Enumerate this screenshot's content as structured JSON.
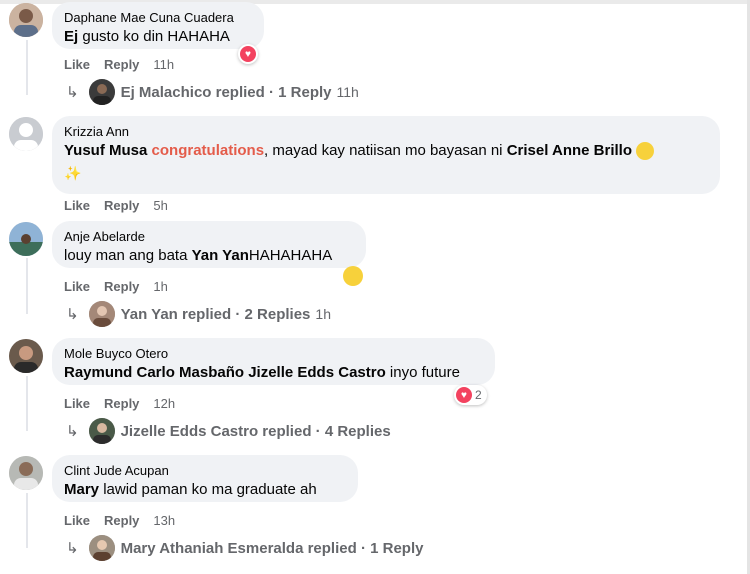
{
  "comments": [
    {
      "name": "Daphane Mae Cuna Cuadera",
      "text_tag": "Ej",
      "text_rest": " gusto ko din HAHAHA",
      "like": "Like",
      "reply": "Reply",
      "time": "11h",
      "replies_author": "Ej Malachico replied",
      "replies_count": "· 1 Reply",
      "replies_time": "11h"
    },
    {
      "name": "Krizzia Ann",
      "text_tag": "Yusuf Musa",
      "text_red": "congratulations",
      "text_mid": ", mayad kay natiisan mo bayasan ni ",
      "text_tag2": "Crisel Anne Brillo",
      "like": "Like",
      "reply": "Reply",
      "time": "5h"
    },
    {
      "name": "Anje Abelarde",
      "text_pre": "louy man ang bata ",
      "text_tag": "Yan Yan",
      "text_rest": "HAHAHAHA",
      "like": "Like",
      "reply": "Reply",
      "time": "1h",
      "replies_author": "Yan Yan replied",
      "replies_count": "· 2 Replies",
      "replies_time": "1h"
    },
    {
      "name": "Mole Buyco Otero",
      "text_tag": "Raymund Carlo Masbaño Jizelle Edds Castro",
      "text_rest": " inyo future",
      "like": "Like",
      "reply": "Reply",
      "time": "12h",
      "reaction_count": "2",
      "replies_author": "Jizelle Edds Castro replied",
      "replies_count": "· 4 Replies"
    },
    {
      "name": "Clint Jude Acupan",
      "text_tag": "Mary",
      "text_rest": " lawid paman ko ma graduate ah",
      "like": "Like",
      "reply": "Reply",
      "time": "13h",
      "replies_author": "Mary Athaniah Esmeralda replied",
      "replies_count": "· 1 Reply"
    }
  ],
  "icons": {
    "reply_arrow": "reply-arrow-icon",
    "heart": "heart-reaction-icon",
    "laugh": "laugh-emoji-icon",
    "sparkles": "sparkles-emoji-icon"
  },
  "colors": {
    "bubble": "#f0f2f5",
    "meta": "#65676b",
    "highlight": "#e45c4a",
    "heart": "#f3425f"
  }
}
